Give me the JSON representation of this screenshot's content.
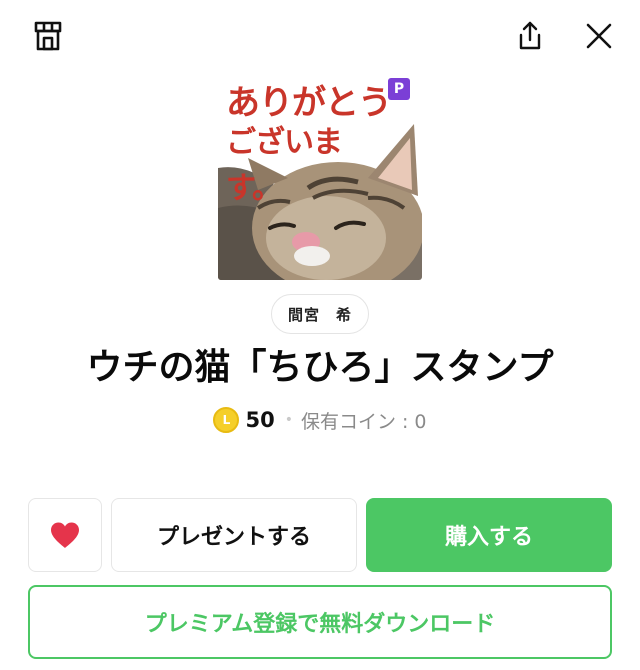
{
  "header": {
    "shop_icon": "shop-icon",
    "share_icon": "share-icon",
    "close_icon": "close-icon"
  },
  "sticker": {
    "caption_line1": "ありがとう",
    "caption_line2": "ございます。",
    "premium_badge": "P",
    "author": "間宮　希",
    "title": "ウチの猫「ちひろ」スタンプ"
  },
  "price": {
    "coin_symbol": "L",
    "amount": "50",
    "separator": "•",
    "owned_coins": "保有コイン : 0"
  },
  "actions": {
    "like_icon": "heart-icon",
    "present_label": "プレゼントする",
    "buy_label": "購入する",
    "premium_label": "プレミアム登録で無料ダウンロード"
  },
  "colors": {
    "accent_green": "#4cc764",
    "heart_red": "#e5344b",
    "badge_purple": "#7b3fd6",
    "coin_gold": "#f5cf2a"
  }
}
